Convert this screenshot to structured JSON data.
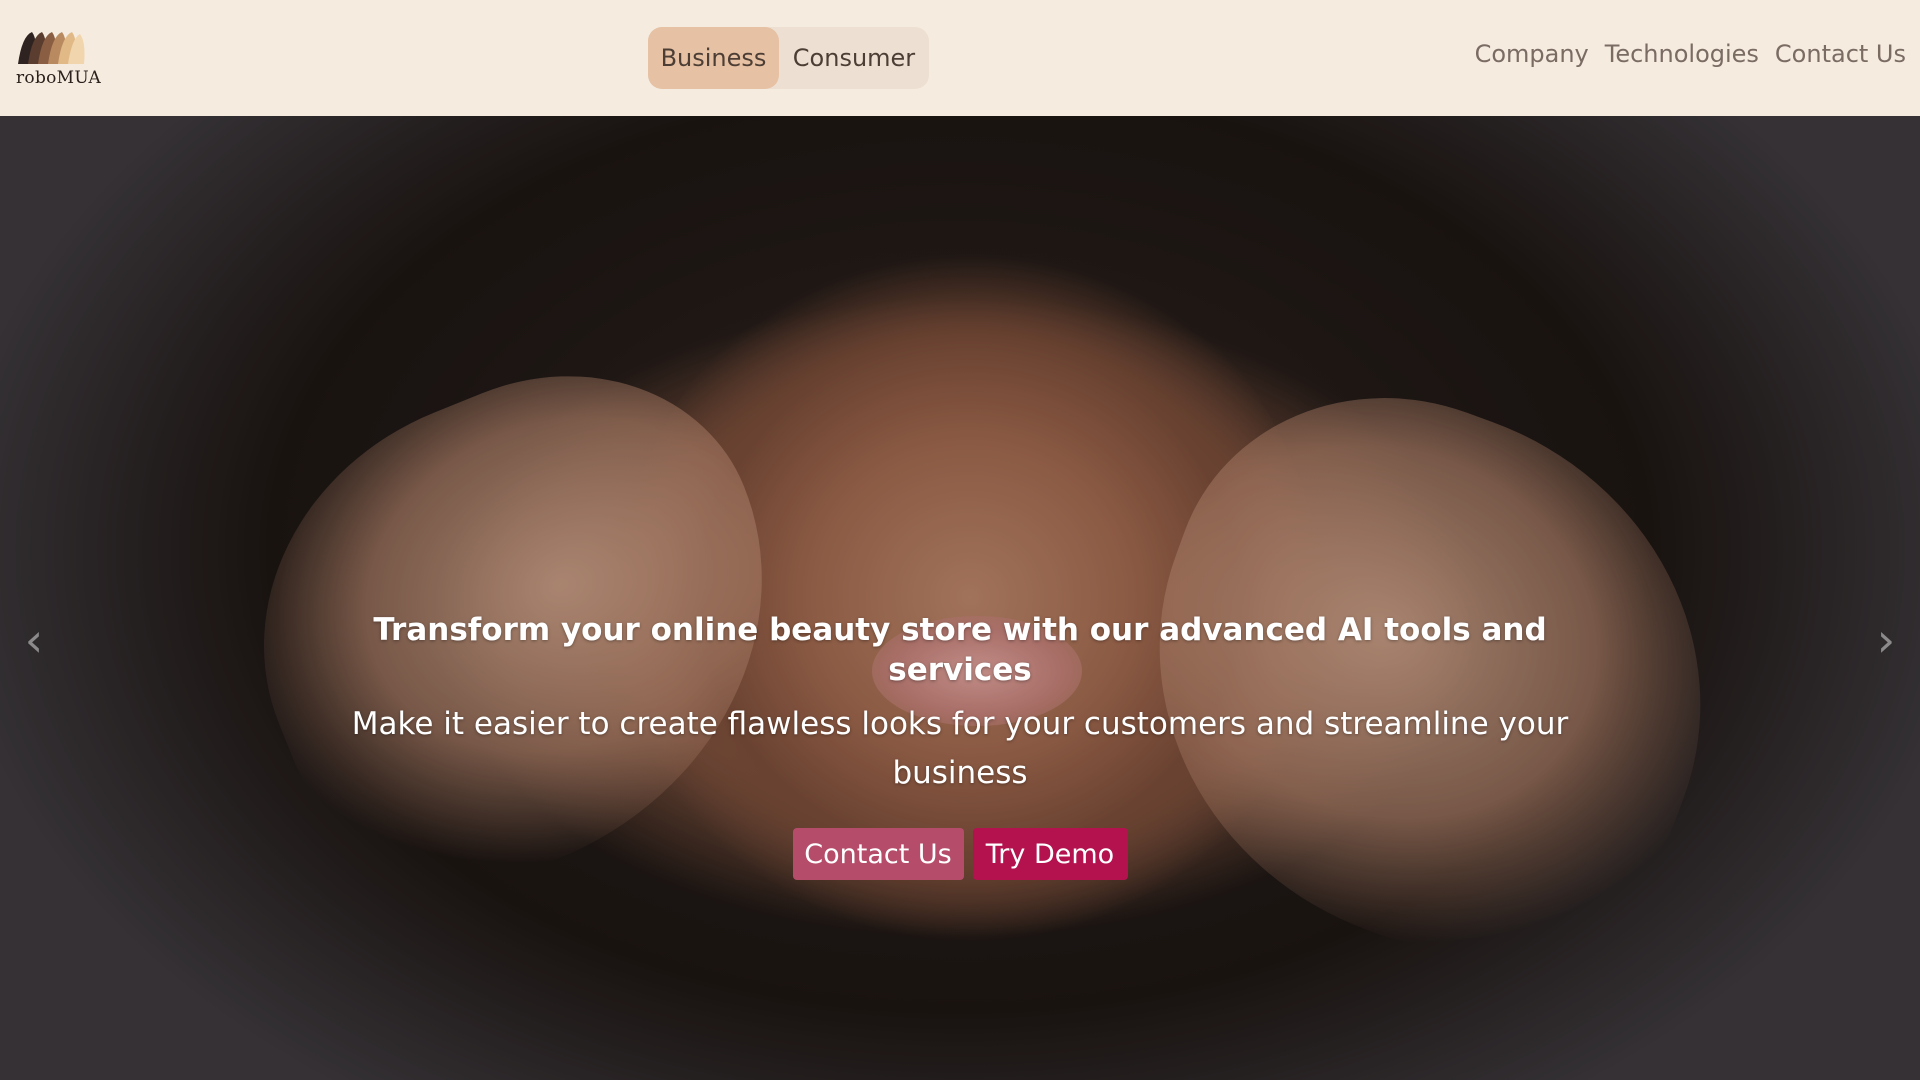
{
  "brand": {
    "name": "roboMUA",
    "icon": "shade-swatch-logo-icon",
    "swatch_colors": [
      "#2e2320",
      "#5a3d2e",
      "#8a5e42",
      "#b98a60",
      "#e1b987",
      "#f1d5ad"
    ]
  },
  "segment_toggle": {
    "options": [
      {
        "label": "Business",
        "active": true
      },
      {
        "label": "Consumer",
        "active": false
      }
    ]
  },
  "nav": {
    "items": [
      "Company",
      "Technologies",
      "Contact Us"
    ]
  },
  "hero": {
    "title": "Transform your online beauty store with our advanced AI tools and services",
    "subtitle": "Make it easier to create flawless looks for your customers and streamline your business",
    "buttons": {
      "contact_label": "Contact Us",
      "demo_label": "Try Demo"
    },
    "prev_icon": "chevron-left-icon",
    "next_icon": "chevron-right-icon",
    "prev_glyph": "‹",
    "next_glyph": "›"
  },
  "colors": {
    "header_bg": "#f5ebdf",
    "segment_active": "#e6c1a3",
    "contact_button": "#b54d6a",
    "demo_button": "#b3124f"
  }
}
